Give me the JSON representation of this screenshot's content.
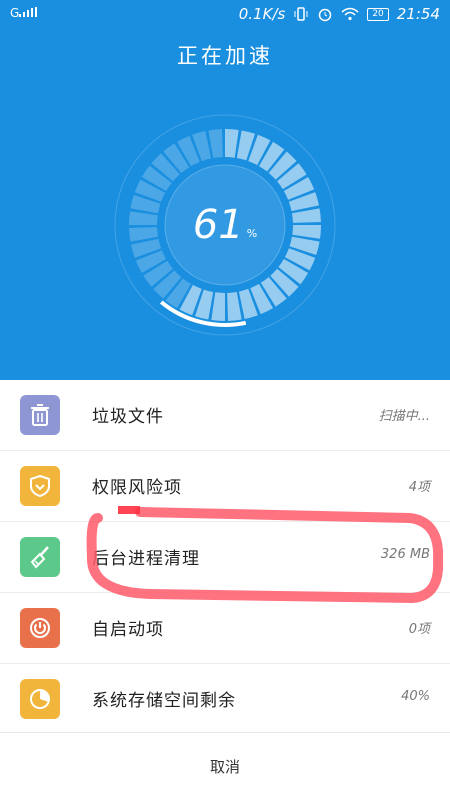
{
  "status_bar": {
    "signal": "G",
    "speed": "0.1K/s",
    "battery": "20",
    "time": "21:54"
  },
  "header": {
    "title": "正在加速"
  },
  "gauge": {
    "value": "61",
    "unit": "%",
    "progress_percent": 61
  },
  "items": [
    {
      "label": "垃圾文件",
      "value": "扫描中...",
      "icon": "trash-icon",
      "color": "#8e97d4"
    },
    {
      "label": "权限风险项",
      "value": "4项",
      "icon": "shield-icon",
      "color": "#f0b53a"
    },
    {
      "label": "后台进程清理",
      "value": "326 MB",
      "icon": "broom-icon",
      "color": "#5cc98a"
    },
    {
      "label": "自启动项",
      "value": "0项",
      "icon": "power-icon",
      "color": "#e8704a"
    },
    {
      "label": "系统存储空间剩余",
      "value": "40%",
      "icon": "pie-chart-icon",
      "color": "#f0b53a"
    }
  ],
  "footer": {
    "cancel_label": "取消"
  },
  "colors": {
    "accent": "#1a8fe0",
    "annotation": "#ff5a6a"
  }
}
